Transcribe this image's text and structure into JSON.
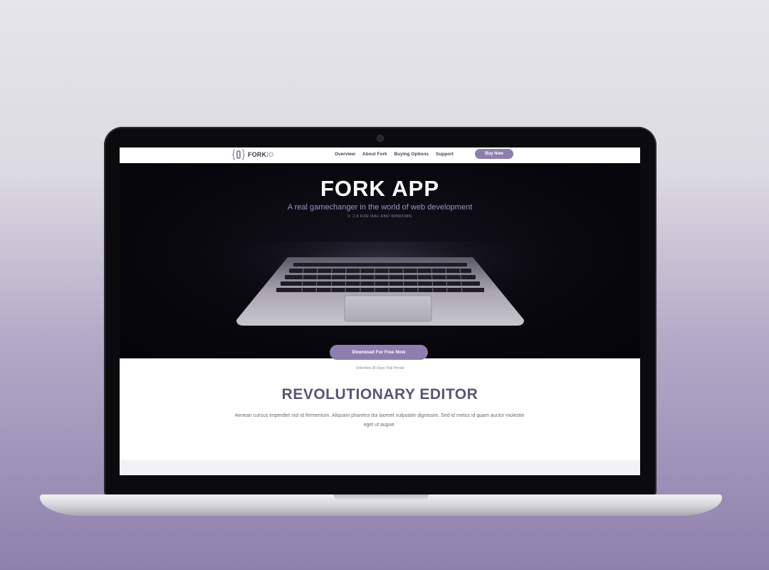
{
  "nav": {
    "logo_main": "FORK",
    "logo_accent": "IO",
    "links": [
      "Overview",
      "About Fork",
      "Buying Options",
      "Support"
    ],
    "buy_label": "Buy Now"
  },
  "hero": {
    "title": "FORK APP",
    "subtitle": "A real gamechanger in the world of web development",
    "version": "V. 2.8 FOR MAC AND WINDOWS",
    "download_label": "Download For Free Now",
    "trial_note": "Unlimited 30-Days Trial Period"
  },
  "section": {
    "title": "REVOLUTIONARY EDITOR",
    "text": "Aenean cursus imperdiet nisl id fermentum. Aliquam pharetra dui laoreet vulputate dignissim. Sed id metus id quam auctor molestie eget ut augue."
  },
  "colors": {
    "accent": "#8c7fb0",
    "heading": "#5a5575",
    "hero_bg": "#08070d"
  },
  "icons": {
    "logo": "curly-brace-fork-icon",
    "hero_image": "laptop-keyboard-photo"
  }
}
